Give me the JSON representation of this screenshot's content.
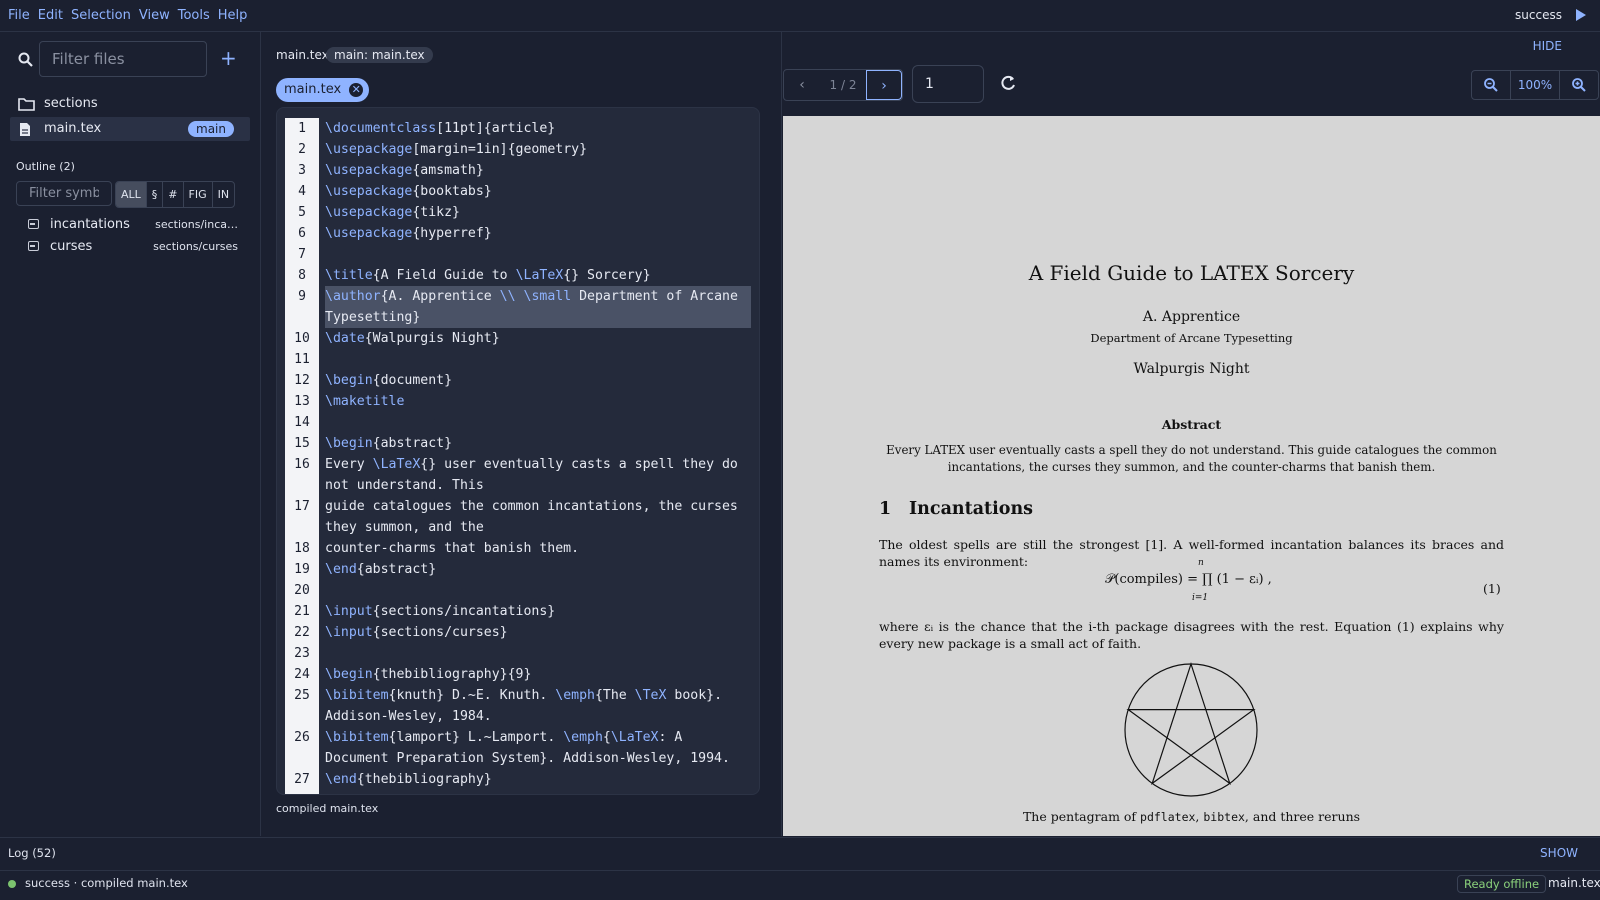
{
  "menu": {
    "items": [
      "File",
      "Edit",
      "Selection",
      "View",
      "Tools",
      "Help"
    ],
    "status": "success"
  },
  "sidebar": {
    "filter_placeholder": "Filter files",
    "tree": [
      {
        "label": "sections",
        "icon": "folder-icon"
      },
      {
        "label": "main.tex",
        "icon": "file-icon",
        "badge": "main"
      }
    ],
    "outline": {
      "title": "Outline (2)",
      "filter_placeholder": "Filter symbols",
      "filters": [
        "ALL",
        "§",
        "#",
        "FIG",
        "IN"
      ],
      "items": [
        {
          "label": "incantations",
          "path": "sections/inca…"
        },
        {
          "label": "curses",
          "path": "sections/curses"
        }
      ]
    }
  },
  "editor": {
    "breadcrumb_file": "main.tex",
    "breadcrumb_pill": "main: main.tex",
    "tab_label": "main.tex",
    "footer": "compiled main.tex",
    "highlighted_line": 9,
    "lines": [
      {
        "n": "1",
        "text": "\\documentclass[11pt]{article}"
      },
      {
        "n": "2",
        "text": "\\usepackage[margin=1in]{geometry}"
      },
      {
        "n": "3",
        "text": "\\usepackage{amsmath}"
      },
      {
        "n": "4",
        "text": "\\usepackage{booktabs}"
      },
      {
        "n": "5",
        "text": "\\usepackage{tikz}"
      },
      {
        "n": "6",
        "text": "\\usepackage{hyperref}"
      },
      {
        "n": "7",
        "text": ""
      },
      {
        "n": "8",
        "text": "\\title{A Field Guide to \\LaTeX{} Sorcery}"
      },
      {
        "n": "9",
        "text": "\\author{A. Apprentice \\\\ \\small Department of Arcane Typesetting}"
      },
      {
        "n": "10",
        "text": "\\date{Walpurgis Night}"
      },
      {
        "n": "11",
        "text": ""
      },
      {
        "n": "12",
        "text": "\\begin{document}"
      },
      {
        "n": "13",
        "text": "\\maketitle"
      },
      {
        "n": "14",
        "text": ""
      },
      {
        "n": "15",
        "text": "\\begin{abstract}"
      },
      {
        "n": "16",
        "text": "Every \\LaTeX{} user eventually casts a spell they do not understand. This"
      },
      {
        "n": "17",
        "text": "guide catalogues the common incantations, the curses they summon, and the"
      },
      {
        "n": "18",
        "text": "counter-charms that banish them."
      },
      {
        "n": "19",
        "text": "\\end{abstract}"
      },
      {
        "n": "20",
        "text": ""
      },
      {
        "n": "21",
        "text": "\\input{sections/incantations}"
      },
      {
        "n": "22",
        "text": "\\input{sections/curses}"
      },
      {
        "n": "23",
        "text": ""
      },
      {
        "n": "24",
        "text": "\\begin{thebibliography}{9}"
      },
      {
        "n": "25",
        "text": "\\bibitem{knuth} D.~E. Knuth. \\emph{The \\TeX book}. Addison-Wesley, 1984."
      },
      {
        "n": "26",
        "text": "\\bibitem{lamport} L.~Lamport. \\emph{\\LaTeX: A Document Preparation System}. Addison-Wesley, 1994."
      },
      {
        "n": "27",
        "text": "\\end{thebibliography}"
      }
    ]
  },
  "preview": {
    "hide_label": "HIDE",
    "page_indicator": "1 / 2",
    "page_input": "1",
    "zoom": "100%",
    "doc": {
      "title": "A Field Guide to LATEX Sorcery",
      "author": "A. Apprentice",
      "affiliation": "Department of Arcane Typesetting",
      "date": "Walpurgis Night",
      "abstract_heading": "Abstract",
      "abstract": "Every LATEX user eventually casts a spell they do not understand. This guide catalogues the common incantations, the curses they summon, and the counter-charms that banish them.",
      "section_number": "1",
      "section_title": "Incantations",
      "para1": "The oldest spells are still the strongest [1]. A well-formed incantation balances its braces and names its environment:",
      "equation": "𝒫(compiles) = ∏ (1 − εᵢ) ,",
      "equation_upper": "n",
      "equation_lower": "i=1",
      "equation_number": "(1)",
      "para2": "where εᵢ is the chance that the i-th package disagrees with the rest. Equation (1) explains why every new package is a small act of faith.",
      "caption": {
        "prefix": "The pentagram of ",
        "t1": "pdflatex",
        "sep1": ", ",
        "t2": "bibtex",
        "suffix": ", and three reruns"
      }
    }
  },
  "log": {
    "title": "Log (52)",
    "show_label": "SHOW"
  },
  "statusbar": {
    "message": "success · compiled main.tex",
    "ready": "Ready offline",
    "file": "main.tex"
  },
  "colors": {
    "accent": "#8fb3ff",
    "background": "#1b2030",
    "editor_bg": "#242a3b",
    "success": "#7cc36e"
  }
}
